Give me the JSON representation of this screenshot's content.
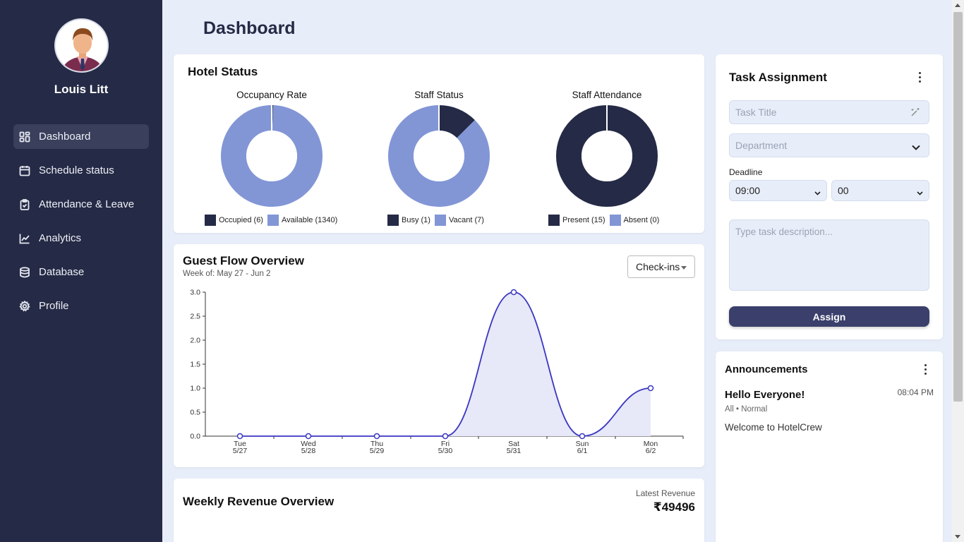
{
  "sidebar": {
    "user_name": "Louis Litt",
    "items": [
      {
        "label": "Dashboard",
        "icon": "dashboard-icon",
        "active": true
      },
      {
        "label": "Schedule status",
        "icon": "calendar-icon"
      },
      {
        "label": "Attendance & Leave",
        "icon": "clipboard-icon"
      },
      {
        "label": "Analytics",
        "icon": "chart-icon"
      },
      {
        "label": "Database",
        "icon": "database-icon"
      },
      {
        "label": "Profile",
        "icon": "gear-icon"
      }
    ]
  },
  "header": {
    "title": "Dashboard"
  },
  "colors": {
    "dark": "#252a46",
    "light": "#8296d6",
    "accent": "#3a3f6b",
    "line": "#3a36c2",
    "fill": "#e7e8f8"
  },
  "hotel_status": {
    "title": "Hotel Status",
    "charts": [
      {
        "title": "Occupancy Rate",
        "segments": [
          {
            "label": "Occupied (6)",
            "value": 6,
            "color": "#252a46"
          },
          {
            "label": "Available (1340)",
            "value": 1340,
            "color": "#8296d6"
          }
        ]
      },
      {
        "title": "Staff Status",
        "segments": [
          {
            "label": "Busy (1)",
            "value": 1,
            "color": "#252a46"
          },
          {
            "label": "Vacant (7)",
            "value": 7,
            "color": "#8296d6"
          }
        ]
      },
      {
        "title": "Staff Attendance",
        "segments": [
          {
            "label": "Present (15)",
            "value": 15,
            "color": "#252a46"
          },
          {
            "label": "Absent (0)",
            "value": 0,
            "color": "#8296d6"
          }
        ]
      }
    ]
  },
  "guest_flow": {
    "title": "Guest Flow Overview",
    "subtitle": "Week of: May 27 - Jun 2",
    "select_value": "Check-ins"
  },
  "chart_data": {
    "type": "area",
    "categories": [
      "Tue 5/27",
      "Wed 5/28",
      "Thu 5/29",
      "Fri 5/30",
      "Sat 5/31",
      "Sun 6/1",
      "Mon 6/2"
    ],
    "x_top": [
      "Tue",
      "Wed",
      "Thu",
      "Fri",
      "Sat",
      "Sun",
      "Mon"
    ],
    "x_bottom": [
      "5/27",
      "5/28",
      "5/29",
      "5/30",
      "5/31",
      "6/1",
      "6/2"
    ],
    "series": [
      {
        "values": [
          0,
          0,
          0,
          0,
          3,
          0,
          1
        ]
      }
    ],
    "ylim": [
      0,
      3
    ],
    "yticks": [
      "0.0",
      "0.5",
      "1.0",
      "1.5",
      "2.0",
      "2.5",
      "3.0"
    ],
    "xlabel": "",
    "ylabel": ""
  },
  "revenue": {
    "title": "Weekly Revenue Overview",
    "latest_label": "Latest Revenue",
    "latest_value": "₹49496"
  },
  "task": {
    "title": "Task Assignment",
    "title_placeholder": "Task Title",
    "department_placeholder": "Department",
    "deadline_label": "Deadline",
    "hour": "09:00",
    "minute": "00",
    "description_placeholder": "Type task description...",
    "assign_label": "Assign"
  },
  "announcements": {
    "title": "Announcements",
    "items": [
      {
        "title": "Hello Everyone!",
        "time": "08:04 PM",
        "meta": "All • Normal",
        "body": "Welcome to HotelCrew"
      }
    ]
  }
}
